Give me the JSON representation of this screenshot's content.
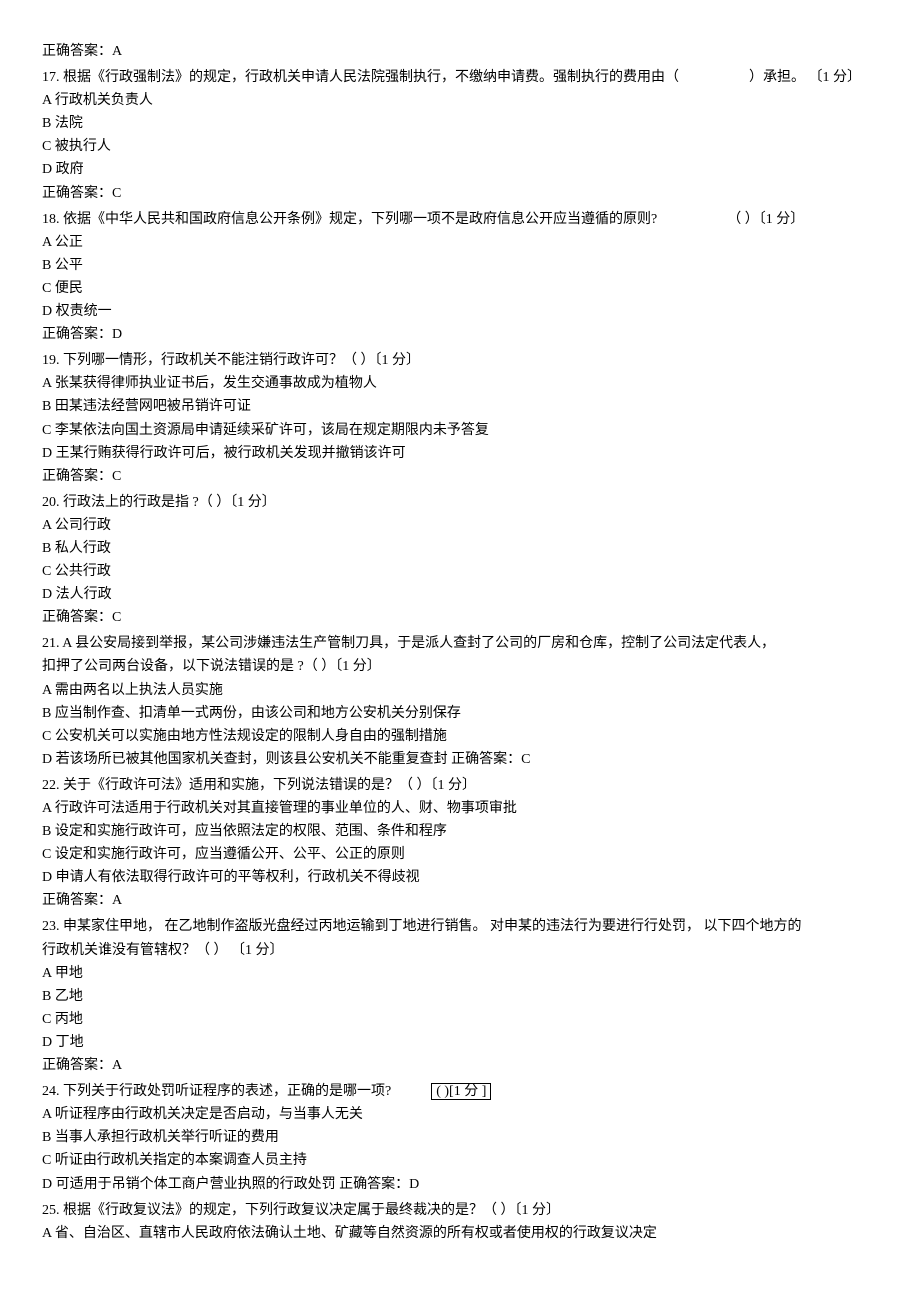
{
  "pre_answer": "正确答案：A",
  "q17": {
    "stem": "17.  根据《行政强制法》的规定，行政机关申请人民法院强制执行，不缴纳申请费。强制执行的费用由（",
    "stem_tail": "）承担。 〔1 分〕",
    "a": "A 行政机关负责人",
    "b": "B 法院",
    "c": "C 被执行人",
    "d": "D 政府",
    "ans": "正确答案：C"
  },
  "q18": {
    "stem": "18.  依据《中华人民共和国政府信息公开条例》规定，下列哪一项不是政府信息公开应当遵循的原则?",
    "stem_tail": "（ ）〔1 分〕",
    "a": "A 公正",
    "b": "B 公平",
    "c": "C 便民",
    "d": "D 权责统一",
    "ans": "正确答案：D"
  },
  "q19": {
    "stem": "19.  下列哪一情形，行政机关不能注销行政许可？（       ）〔1 分〕",
    "a": "A 张某获得律师执业证书后，发生交通事故成为植物人",
    "b": "B 田某违法经营网吧被吊销许可证",
    "c": "C 李某依法向国土资源局申请延续采矿许可，该局在规定期限内未予答复",
    "d": "D 王某行贿获得行政许可后，被行政机关发现并撤销该许可",
    "ans": "正确答案：C"
  },
  "q20": {
    "stem": "20.  行政法上的行政是指  ?（ ）〔1 分〕",
    "a": "A 公司行政",
    "b": "B 私人行政",
    "c": "C 公共行政",
    "d": "D 法人行政",
    "ans": "正确答案：C"
  },
  "q21": {
    "stem1": "21.  A 县公安局接到举报，某公司涉嫌违法生产管制刀具，于是派人查封了公司的厂房和仓库，控制了公司法定代表人，",
    "stem2": "扣押了公司两台设备，以下说法错误的是     ?（ ）〔1 分〕",
    "a": "A 需由两名以上执法人员实施",
    "b": "B 应当制作查、扣清单一式两份，由该公司和地方公安机关分别保存",
    "c": "C 公安机关可以实施由地方性法规设定的限制人身自由的强制措施",
    "d": "D 若该场所已被其他国家机关查封，则该县公安机关不能重复查封  正确答案：C"
  },
  "q22": {
    "stem": "22.  关于《行政许可法》适用和实施，下列说法错误的是？（        ）〔1 分〕",
    "a": "A 行政许可法适用于行政机关对其直接管理的事业单位的人、财、物事项审批",
    "b": "B 设定和实施行政许可，应当依照法定的权限、范围、条件和程序",
    "c": "C 设定和实施行政许可，应当遵循公开、公平、公正的原则",
    "d": "D 申请人有依法取得行政许可的平等权利，行政机关不得歧视",
    "ans": "正确答案：A"
  },
  "q23": {
    "stem1": "23.  申某家住甲地，   在乙地制作盗版光盘经过丙地运输到丁地进行销售。   对申某的违法行为要进行行处罚，   以下四个地方的",
    "stem2": "行政机关谁没有管辖权？（     ） 〔1 分〕",
    "a": "A 甲地",
    "b": "B 乙地",
    "c": "C 丙地",
    "d": "D 丁地",
    "ans": "正确答案：A"
  },
  "q24": {
    "stem_pre": "24.  下列关于行政处罚听证程序的表述，正确的是哪一项?",
    "stem_boxed": "( )[1 分 ]",
    "a": "A 听证程序由行政机关决定是否启动，与当事人无关",
    "b": "B 当事人承担行政机关举行听证的费用",
    "c": "C 听证由行政机关指定的本案调查人员主持",
    "d": "D 可适用于吊销个体工商户营业执照的行政处罚  正确答案：D"
  },
  "q25": {
    "stem": "25.  根据《行政复议法》的规定，下列行政复议决定属于最终裁决的是？（           ）〔1 分〕",
    "a": "A 省、自治区、直辖市人民政府依法确认土地、矿藏等自然资源的所有权或者使用权的行政复议决定"
  }
}
